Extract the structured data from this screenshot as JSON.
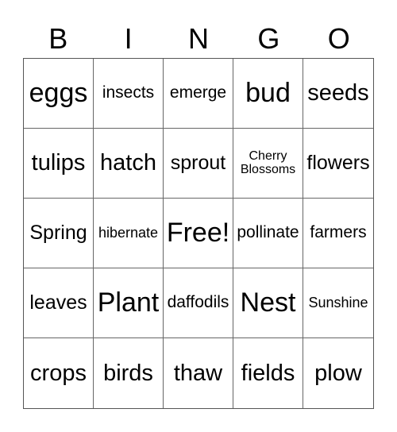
{
  "header": {
    "letters": [
      "B",
      "I",
      "N",
      "G",
      "O"
    ]
  },
  "board": {
    "rows": [
      [
        {
          "text": "eggs",
          "size": "s-xl"
        },
        {
          "text": "insects",
          "size": "s-s"
        },
        {
          "text": "emerge",
          "size": "s-s"
        },
        {
          "text": "bud",
          "size": "s-xl"
        },
        {
          "text": "seeds",
          "size": "s-l"
        }
      ],
      [
        {
          "text": "tulips",
          "size": "s-l"
        },
        {
          "text": "hatch",
          "size": "s-l"
        },
        {
          "text": "sprout",
          "size": "s-m"
        },
        {
          "text": "Cherry Blossoms",
          "size": "s-xxs"
        },
        {
          "text": "flowers",
          "size": "s-m"
        }
      ],
      [
        {
          "text": "Spring",
          "size": "s-m"
        },
        {
          "text": "hibernate",
          "size": "s-xs"
        },
        {
          "text": "Free!",
          "size": "s-xl"
        },
        {
          "text": "pollinate",
          "size": "s-s"
        },
        {
          "text": "farmers",
          "size": "s-s"
        }
      ],
      [
        {
          "text": "leaves",
          "size": "s-m"
        },
        {
          "text": "Plant",
          "size": "s-xl"
        },
        {
          "text": "daffodils",
          "size": "s-s"
        },
        {
          "text": "Nest",
          "size": "s-xl"
        },
        {
          "text": "Sunshine",
          "size": "s-xs"
        }
      ],
      [
        {
          "text": "crops",
          "size": "s-l"
        },
        {
          "text": "birds",
          "size": "s-l"
        },
        {
          "text": "thaw",
          "size": "s-l"
        },
        {
          "text": "fields",
          "size": "s-l"
        },
        {
          "text": "plow",
          "size": "s-l"
        }
      ]
    ]
  }
}
